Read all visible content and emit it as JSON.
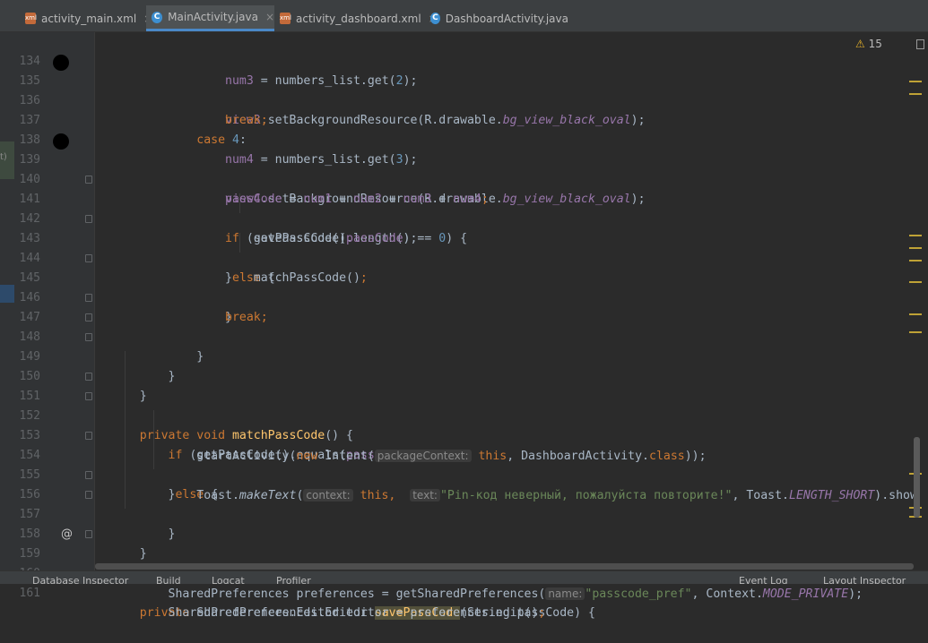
{
  "tabs": [
    {
      "label": "activity_main.xml",
      "type": "xml",
      "active": false
    },
    {
      "label": "MainActivity.java",
      "type": "java",
      "active": true
    },
    {
      "label": "activity_dashboard.xml",
      "type": "xml",
      "active": false
    },
    {
      "label": "DashboardActivity.java",
      "type": "java",
      "active": false
    }
  ],
  "close_glyph": "×",
  "tab_icon_glyphs": {
    "xml": "xml",
    "java": "C"
  },
  "inspections": {
    "icon": "warning-triangle-icon",
    "glyph": "⚠",
    "count": "15"
  },
  "left_panel_label": "t)",
  "line_numbers": [
    "134",
    "135",
    "136",
    "137",
    "138",
    "139",
    "140",
    "141",
    "142",
    "143",
    "144",
    "145",
    "146",
    "147",
    "148",
    "149",
    "150",
    "151",
    "152",
    "153",
    "154",
    "155",
    "156",
    "157",
    "158",
    "159",
    "160",
    "161"
  ],
  "code": {
    "l134_a": "num3",
    "l134_b": " = numbers_list.get(",
    "l134_c": "2",
    "l134_d": ");",
    "l135_a": "view3",
    "l135_b": ".setBackgroundResource(R.drawable.",
    "l135_c": "bg_view_black_oval",
    "l135_d": ");",
    "l136_a": "break",
    "l136_b": ";",
    "l137_a": "case ",
    "l137_b": "4",
    "l137_c": ":",
    "l138_a": "num4",
    "l138_b": " = numbers_list.get(",
    "l138_c": "3",
    "l138_d": ");",
    "l139_a": "view4",
    "l139_b": ".setBackgroundResource(R.drawable.",
    "l139_c": "bg_view_black_oval",
    "l139_d": ");",
    "l140_a": "passCode",
    "l140_b": " = ",
    "l140_c": "num1",
    "l140_d": " + ",
    "l140_e": "num2",
    "l140_f": " + ",
    "l140_g": "num3",
    "l140_h": " + ",
    "l140_i": "num4",
    "l140_j": ";",
    "l141_a": "if ",
    "l141_b": "(getPassCode().length() == ",
    "l141_c": "0",
    "l141_d": ") {",
    "l142_a": "savePassCode(",
    "l142_b": "passCode",
    "l142_c": ");",
    "l143_a": "}",
    "l143_b": "else ",
    "l143_c": "{",
    "l144_a": "matchPassCode()",
    "l144_b": ";",
    "l145_a": "}",
    "l146_a": "break",
    "l146_b": ";",
    "l147_a": "}",
    "l148_a": "}",
    "l149_a": "}",
    "l151_a": "private void ",
    "l151_b": "matchPassCode",
    "l151_c": "() {",
    "l152_a": "if ",
    "l152_b": "(getPassCode().equals(",
    "l152_c": "passCode",
    "l152_d": ")) {",
    "l153_a": "startActivity(",
    "l153_b": "new ",
    "l153_c": "Intent(",
    "l153_d": "packageContext:",
    "l153_e": " this",
    "l153_f": ", DashboardActivity.",
    "l153_g": "class",
    "l153_h": "));",
    "l154_a": "}",
    "l154_b": "else ",
    "l154_c": "{",
    "l155_a": "Toast.",
    "l155_b": "makeText",
    "l155_c": "(",
    "l155_d": "context:",
    "l155_e": " this",
    "l155_f": ",  ",
    "l155_g": "text:",
    "l155_h": "\"Pin-код неверный, пожалуйста повторите!\"",
    "l155_i": ", Toast.",
    "l155_j": "LENGTH_SHORT",
    "l155_k": ").show()",
    "l155_l": ";",
    "l156_a": "}",
    "l157_a": "}",
    "l159_a": "private ",
    "l159_b": "SharedPreferences.Editor ",
    "l159_c": "savePassCode",
    "l159_d": "(String passCode) {",
    "l160_a": "SharedPreferences preferences = getSharedPreferences(",
    "l160_b": "name:",
    "l160_c": "\"passcode_pref\"",
    "l160_d": ", Context.",
    "l160_e": "MODE_PRIVATE",
    "l160_f": ");",
    "l161_a": "SharedPreferences.Editor editor = preferences.edit()",
    "l161_b": ";"
  },
  "gutter_markers": {
    "override": "@"
  },
  "statusbar": {
    "items": [
      "Database Inspector",
      "Build",
      "Logcat",
      "Profiler",
      "Event Log",
      "Layout Inspector"
    ]
  },
  "colors": {
    "background": "#2b2b2b",
    "keyword": "#cc7832",
    "field": "#9876aa",
    "method": "#ffc66d",
    "number": "#6897bb",
    "string": "#6a8759",
    "default": "#a9b7c6",
    "accent": "#4a88c7",
    "warning": "#e5b12a"
  }
}
